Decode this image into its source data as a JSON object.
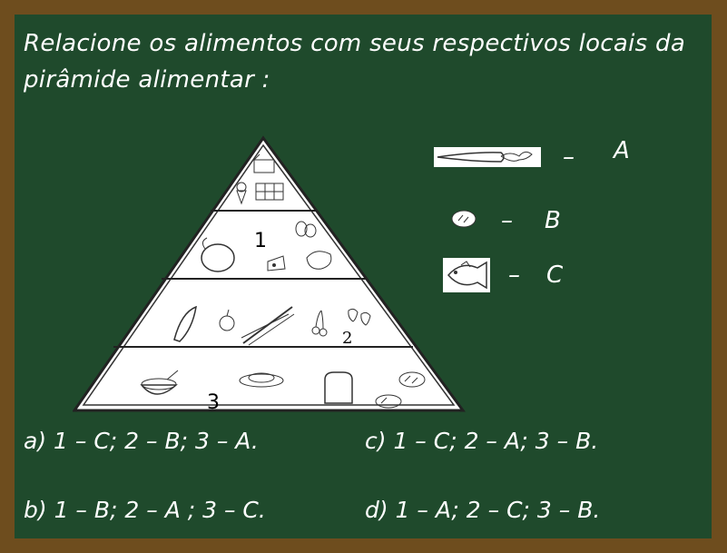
{
  "question": {
    "line1": "Relacione os alimentos com seus respectivos locais da",
    "line2": "pirâmide alimentar :"
  },
  "pyramid": {
    "level_labels": [
      "1",
      "2",
      "3"
    ]
  },
  "legend": [
    {
      "icon": "carrot-icon",
      "dash": "–",
      "letter": "A"
    },
    {
      "icon": "bread-roll-icon",
      "dash": "–",
      "letter": "B"
    },
    {
      "icon": "fish-icon",
      "dash": "–",
      "letter": "C"
    }
  ],
  "options": {
    "a": "a) 1 – C; 2 – B; 3 – A.",
    "b": "b) 1 – B; 2 – A ; 3 – C.",
    "c": "c) 1 – C; 2 – A; 3 – B.",
    "d": "d) 1 – A; 2 – C; 3 – B."
  },
  "colors": {
    "board": "#1f4a2c",
    "frame": "#6e4d1e",
    "chalk": "#ffffff"
  }
}
